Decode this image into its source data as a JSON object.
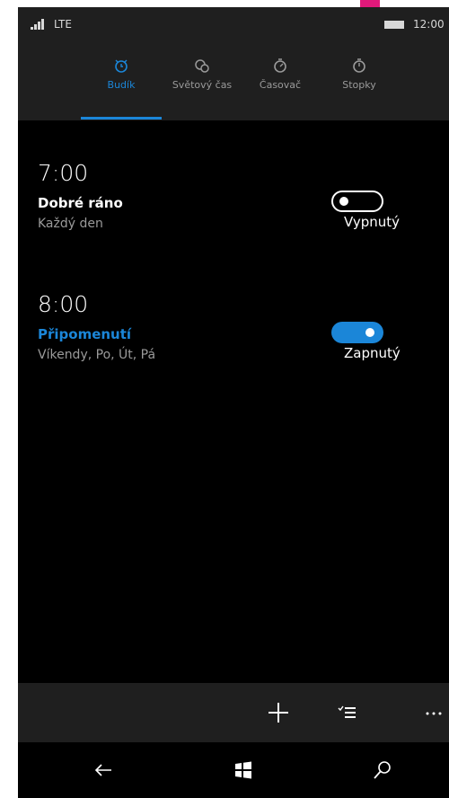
{
  "status_bar": {
    "network": "LTE",
    "time": "12:00"
  },
  "tabs": [
    {
      "label": "Budík",
      "icon": "alarm-icon",
      "active": true
    },
    {
      "label": "Světový čas",
      "icon": "world-clock-icon",
      "active": false
    },
    {
      "label": "Časovač",
      "icon": "timer-icon",
      "active": false
    },
    {
      "label": "Stopky",
      "icon": "stopwatch-icon",
      "active": false
    }
  ],
  "alarms": [
    {
      "time": "7:00",
      "name": "Dobré ráno",
      "days": "Každý den",
      "enabled": false,
      "state_label": "Vypnutý"
    },
    {
      "time": "8:00",
      "name": "Připomenutí",
      "days": "Víkendy, Po, Út, Pá",
      "enabled": true,
      "state_label": "Zapnutý"
    }
  ],
  "app_bar": {
    "buttons": [
      "add-icon",
      "select-icon",
      "more-icon"
    ]
  },
  "nav_bar": {
    "buttons": [
      "back-icon",
      "windows-icon",
      "search-icon"
    ]
  },
  "colors": {
    "accent": "#1b86d8",
    "background": "#000000",
    "bar": "#1f1f1f",
    "secondary_text": "#9a9a9a"
  }
}
